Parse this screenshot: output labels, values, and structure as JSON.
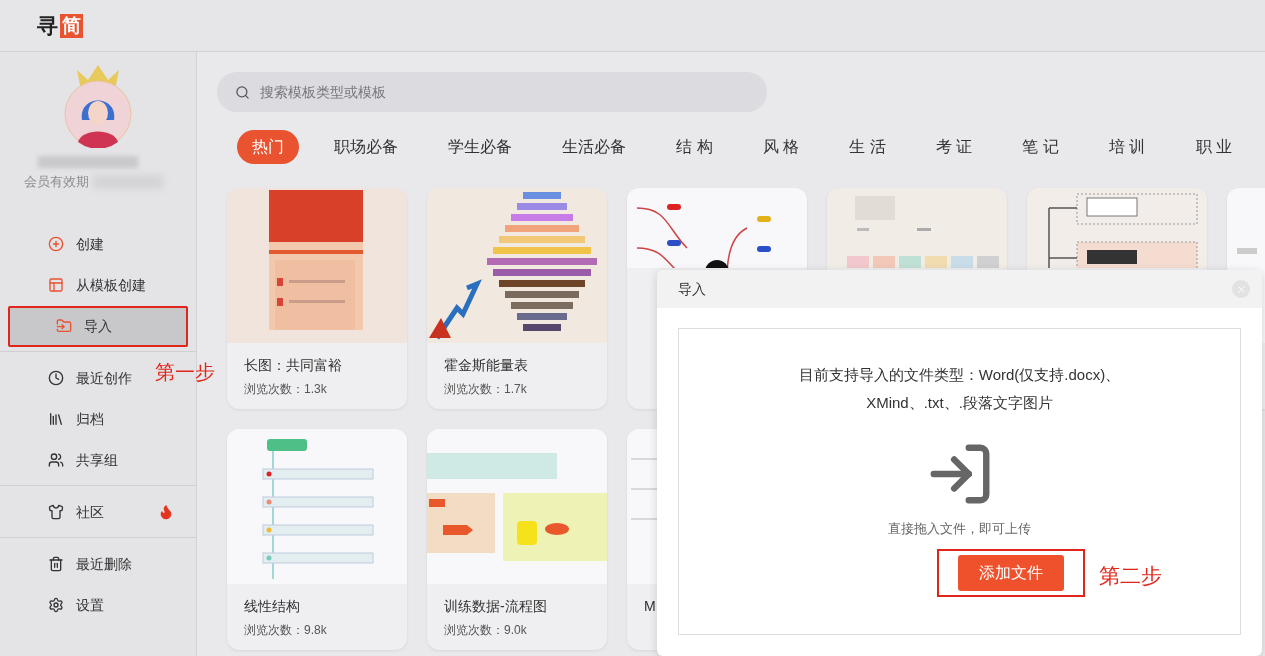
{
  "logo": {
    "mark": "寻",
    "badge": "简"
  },
  "profile": {
    "membership": "会员有效期"
  },
  "nav": [
    [
      {
        "label": "创建",
        "selected": false,
        "hot": false
      },
      {
        "label": "从模板创建",
        "selected": false,
        "hot": false
      },
      {
        "label": "导入",
        "selected": true,
        "hot": false
      }
    ],
    [
      {
        "label": "最近创作",
        "selected": false,
        "hot": false
      },
      {
        "label": "归档",
        "selected": false,
        "hot": false
      },
      {
        "label": "共享组",
        "selected": false,
        "hot": false
      }
    ],
    [
      {
        "label": "社区",
        "selected": false,
        "hot": true
      }
    ],
    [
      {
        "label": "最近删除",
        "selected": false,
        "hot": false
      },
      {
        "label": "设置",
        "selected": false,
        "hot": false
      }
    ]
  ],
  "search": {
    "placeholder": "搜索模板类型或模板"
  },
  "tabs": [
    {
      "label": "热门",
      "selected": true
    },
    {
      "label": "职场必备",
      "selected": false
    },
    {
      "label": "学生必备",
      "selected": false
    },
    {
      "label": "生活必备",
      "selected": false
    },
    {
      "label": "结 构",
      "selected": false
    },
    {
      "label": "风 格",
      "selected": false
    },
    {
      "label": "生 活",
      "selected": false
    },
    {
      "label": "考 证",
      "selected": false
    },
    {
      "label": "笔 记",
      "selected": false
    },
    {
      "label": "培 训",
      "selected": false
    },
    {
      "label": "职 业",
      "selected": false
    }
  ],
  "cards": [
    {
      "title": "长图：共同富裕",
      "views": "浏览次数：1.3k"
    },
    {
      "title": "霍金斯能量表",
      "views": "浏览次数：1.7k"
    },
    {
      "kind": "picture"
    },
    {
      "kind": "picture"
    },
    {
      "kind": "picture"
    },
    {
      "kind": "picture"
    },
    {
      "title": "线性结构",
      "views": "浏览次数：9.8k"
    },
    {
      "title": "训练数据-流程图",
      "views": "浏览次数：9.0k"
    },
    {
      "title": "M"
    }
  ],
  "dialog": {
    "title": "导入",
    "description": "目前支持导入的文件类型：Word(仅支持.docx)、XMind、.txt、.段落文字图片",
    "hint": "直接拖入文件，即可上传",
    "button": "添加文件"
  },
  "annotations": [
    {
      "text": "第一步"
    },
    {
      "text": "第二步"
    }
  ]
}
